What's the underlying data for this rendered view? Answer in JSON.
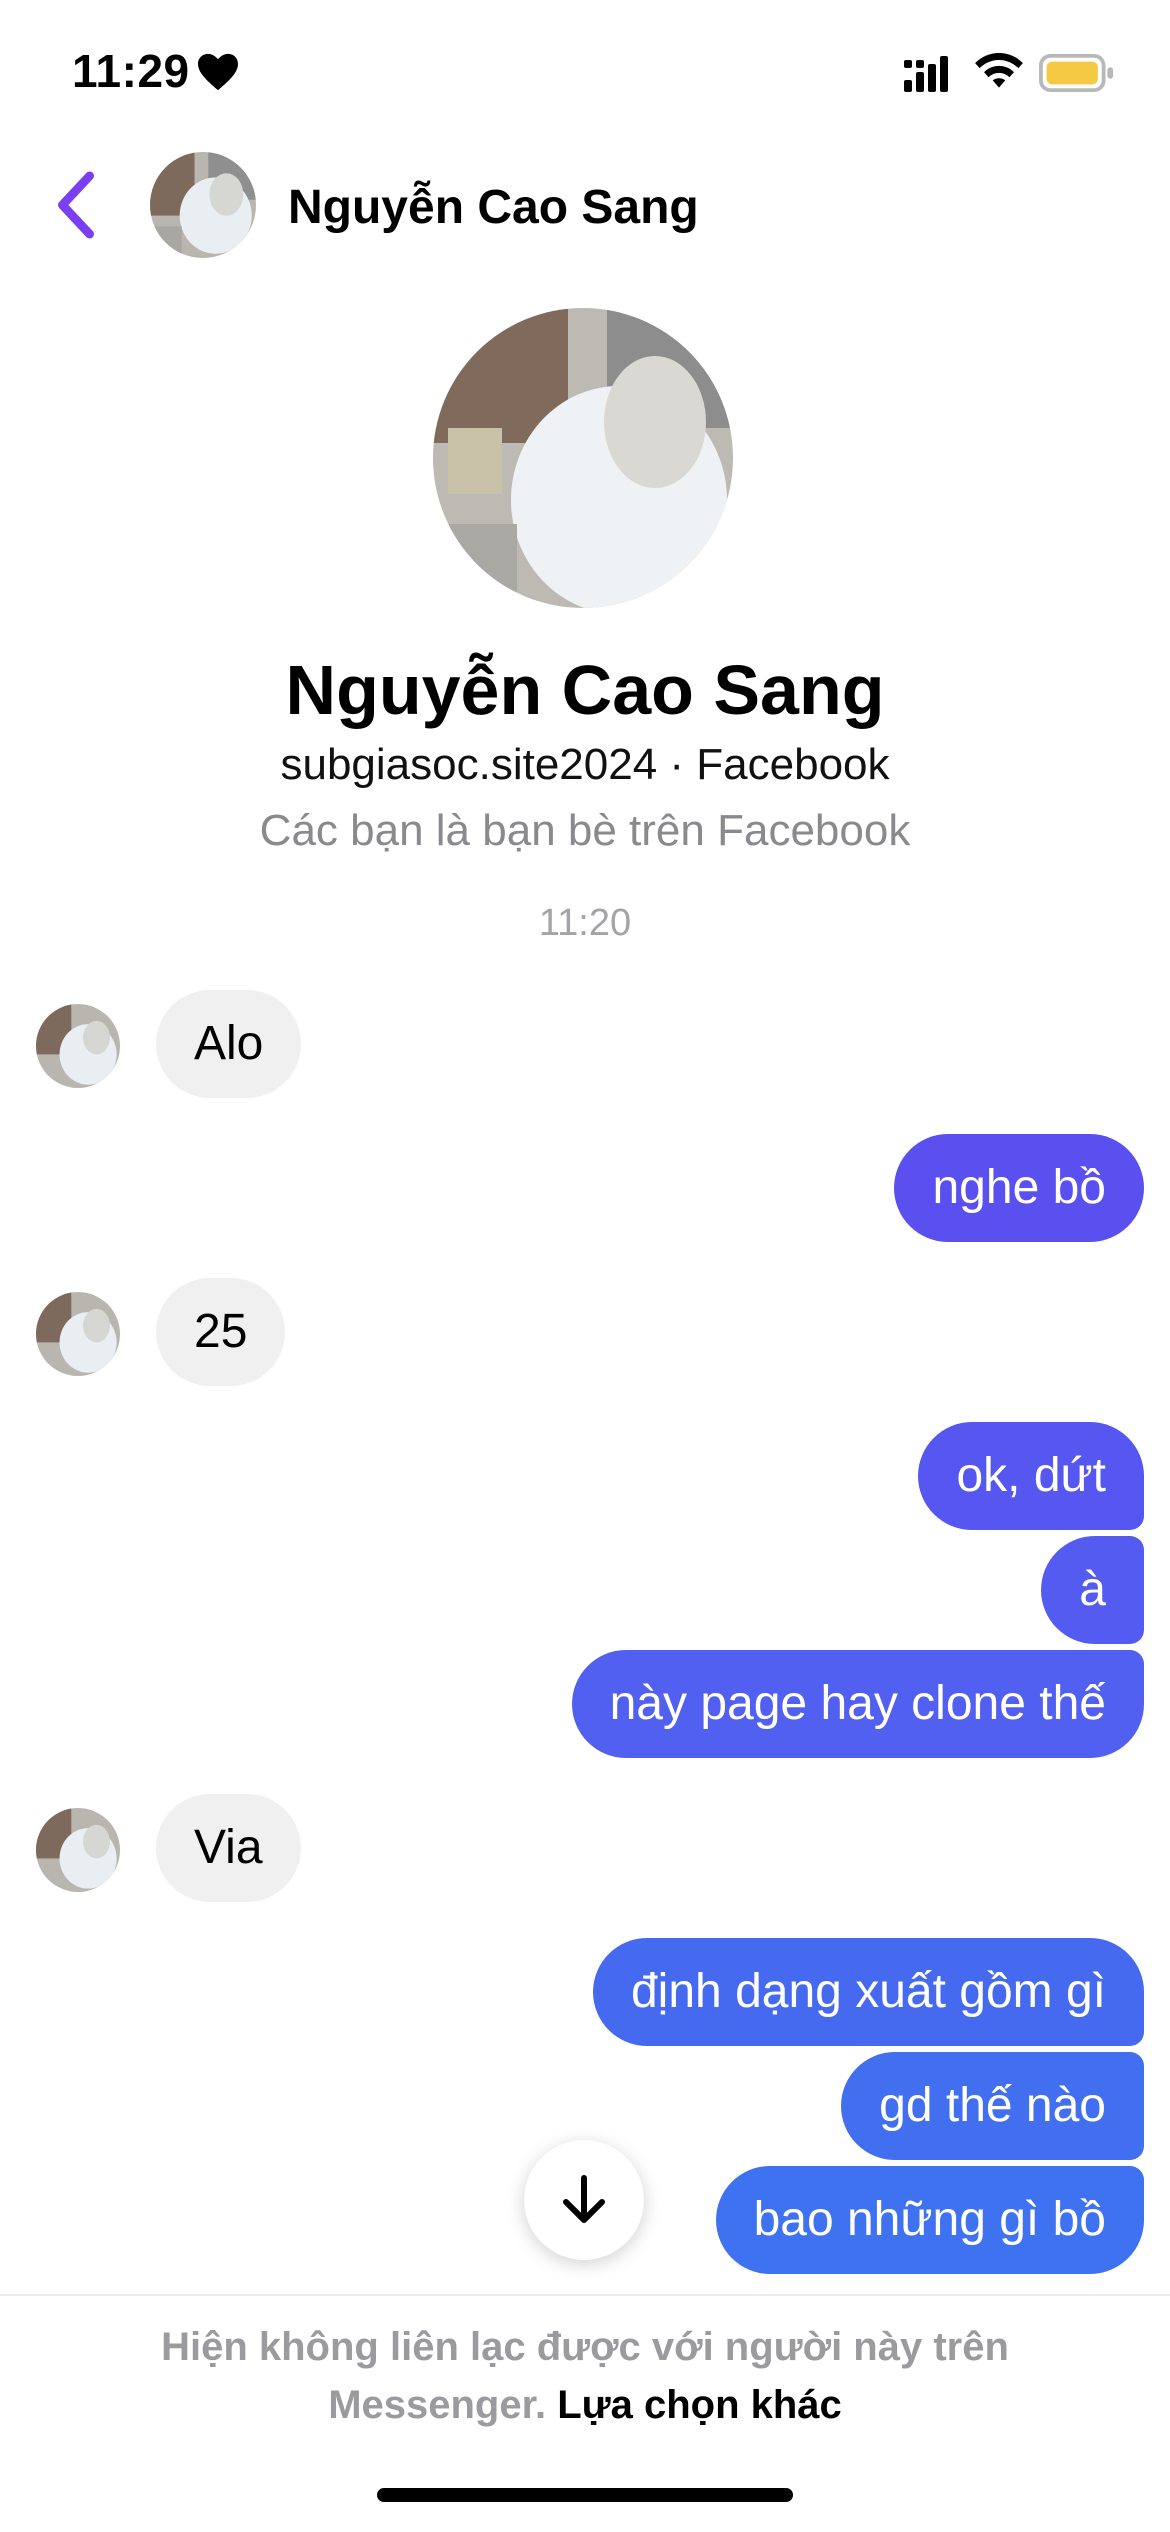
{
  "status_bar": {
    "time": "11:29",
    "icons": [
      "heart-icon",
      "signal-icon",
      "wifi-icon",
      "battery-icon"
    ]
  },
  "header": {
    "back_icon": "chevron-left-icon",
    "contact_name": "Nguyễn Cao Sang"
  },
  "profile": {
    "name": "Nguyễn Cao Sang",
    "meta": "subgiasoc.site2024 · Facebook",
    "friend_status": "Các bạn là bạn bè trên Facebook"
  },
  "conversation": {
    "timestamp": "11:20",
    "messages": [
      {
        "from": "them",
        "text": "Alo"
      },
      {
        "from": "me",
        "text": "nghe bồ"
      },
      {
        "from": "them",
        "text": "25"
      },
      {
        "from": "me",
        "text": "ok, dứt"
      },
      {
        "from": "me",
        "text": "à"
      },
      {
        "from": "me",
        "text": "này page hay clone thế"
      },
      {
        "from": "them",
        "text": "Via"
      },
      {
        "from": "me",
        "text": "định dạng xuất gồm gì"
      },
      {
        "from": "me",
        "text": "gd thế nào"
      },
      {
        "from": "me",
        "text": "bao những gì bồ"
      }
    ]
  },
  "footer": {
    "notice": "Hiện không liên lạc được với người này trên Messenger.",
    "link": "Lựa chọn khác"
  },
  "colors": {
    "accent": "#7b3ff2",
    "incoming_bubble": "#f0f0f0",
    "outgoing_gradient_top": "#5b4ff0",
    "outgoing_gradient_bottom": "#3b6cf0",
    "muted_text": "#8a8a8e"
  }
}
